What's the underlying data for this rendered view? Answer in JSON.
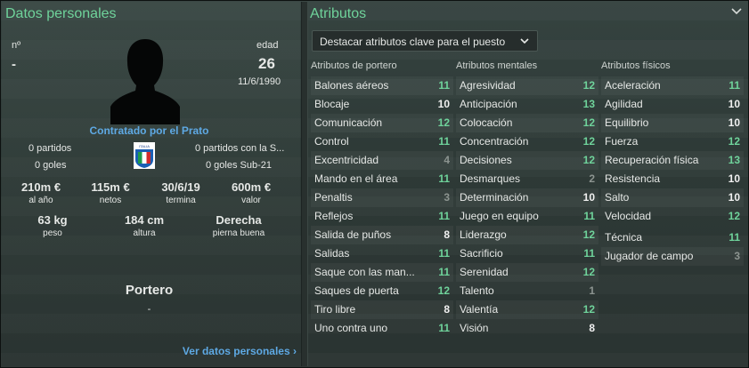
{
  "personal": {
    "title": "Datos personales",
    "number_label": "nº",
    "number_value": "-",
    "age_label": "edad",
    "age_value": "26",
    "dob": "11/6/1990",
    "contract_text": "Contratado por el Prato",
    "flag_text": "ITALIA",
    "matches_left": "0 partidos",
    "goals_left": "0 goles",
    "matches_right": "0 partidos con la S...",
    "goals_right": "0 goles Sub-21",
    "stats": [
      {
        "value": "210m €",
        "label": "al año"
      },
      {
        "value": "115m €",
        "label": "netos"
      },
      {
        "value": "30/6/19",
        "label": "termina"
      },
      {
        "value": "600m €",
        "label": "valor"
      },
      {
        "value": "63 kg",
        "label": "peso"
      },
      {
        "value": "184 cm",
        "label": "altura"
      },
      {
        "value": "Derecha",
        "label": "pierna buena"
      }
    ],
    "position": "Portero",
    "position_sub": "-",
    "view_link": "Ver datos personales"
  },
  "attributes": {
    "title": "Atributos",
    "dropdown_label": "Destacar atributos clave para el puesto",
    "col_headers": [
      "Atributos de portero",
      "Atributos mentales",
      "Atributos físicos"
    ],
    "goalkeeper": [
      {
        "name": "Balones aéreos",
        "value": "11"
      },
      {
        "name": "Blocaje",
        "value": "10"
      },
      {
        "name": "Comunicación",
        "value": "12"
      },
      {
        "name": "Control",
        "value": "11"
      },
      {
        "name": "Excentricidad",
        "value": "4"
      },
      {
        "name": "Mando en el área",
        "value": "11"
      },
      {
        "name": "Penaltis",
        "value": "3"
      },
      {
        "name": "Reflejos",
        "value": "11"
      },
      {
        "name": "Salida de puños",
        "value": "8"
      },
      {
        "name": "Salidas",
        "value": "11"
      },
      {
        "name": "Saque con las man...",
        "value": "11"
      },
      {
        "name": "Saques de puerta",
        "value": "12"
      },
      {
        "name": "Tiro libre",
        "value": "8"
      },
      {
        "name": "Uno contra uno",
        "value": "11"
      }
    ],
    "mental": [
      {
        "name": "Agresividad",
        "value": "12"
      },
      {
        "name": "Anticipación",
        "value": "13"
      },
      {
        "name": "Colocación",
        "value": "12"
      },
      {
        "name": "Concentración",
        "value": "12"
      },
      {
        "name": "Decisiones",
        "value": "12"
      },
      {
        "name": "Desmarques",
        "value": "2"
      },
      {
        "name": "Determinación",
        "value": "10"
      },
      {
        "name": "Juego en equipo",
        "value": "11"
      },
      {
        "name": "Liderazgo",
        "value": "12"
      },
      {
        "name": "Sacrificio",
        "value": "11"
      },
      {
        "name": "Serenidad",
        "value": "12"
      },
      {
        "name": "Talento",
        "value": "1"
      },
      {
        "name": "Valentía",
        "value": "12"
      },
      {
        "name": "Visión",
        "value": "8"
      }
    ],
    "physical": [
      {
        "name": "Aceleración",
        "value": "11"
      },
      {
        "name": "Agilidad",
        "value": "10"
      },
      {
        "name": "Equilibrio",
        "value": "10"
      },
      {
        "name": "Fuerza",
        "value": "12"
      },
      {
        "name": "Recuperación física",
        "value": "13"
      },
      {
        "name": "Resistencia",
        "value": "10"
      },
      {
        "name": "Salto",
        "value": "10"
      },
      {
        "name": "Velocidad",
        "value": "12"
      }
    ],
    "extra": [
      {
        "name": "Técnica",
        "value": "11"
      },
      {
        "name": "Jugador de campo",
        "value": "3"
      }
    ]
  },
  "colors": {
    "title_green": "#6fd39b",
    "value_green": "#6fd39b",
    "value_white": "#f0f0f0",
    "value_grey": "#8c9490",
    "link_blue": "#5ea9e4"
  }
}
